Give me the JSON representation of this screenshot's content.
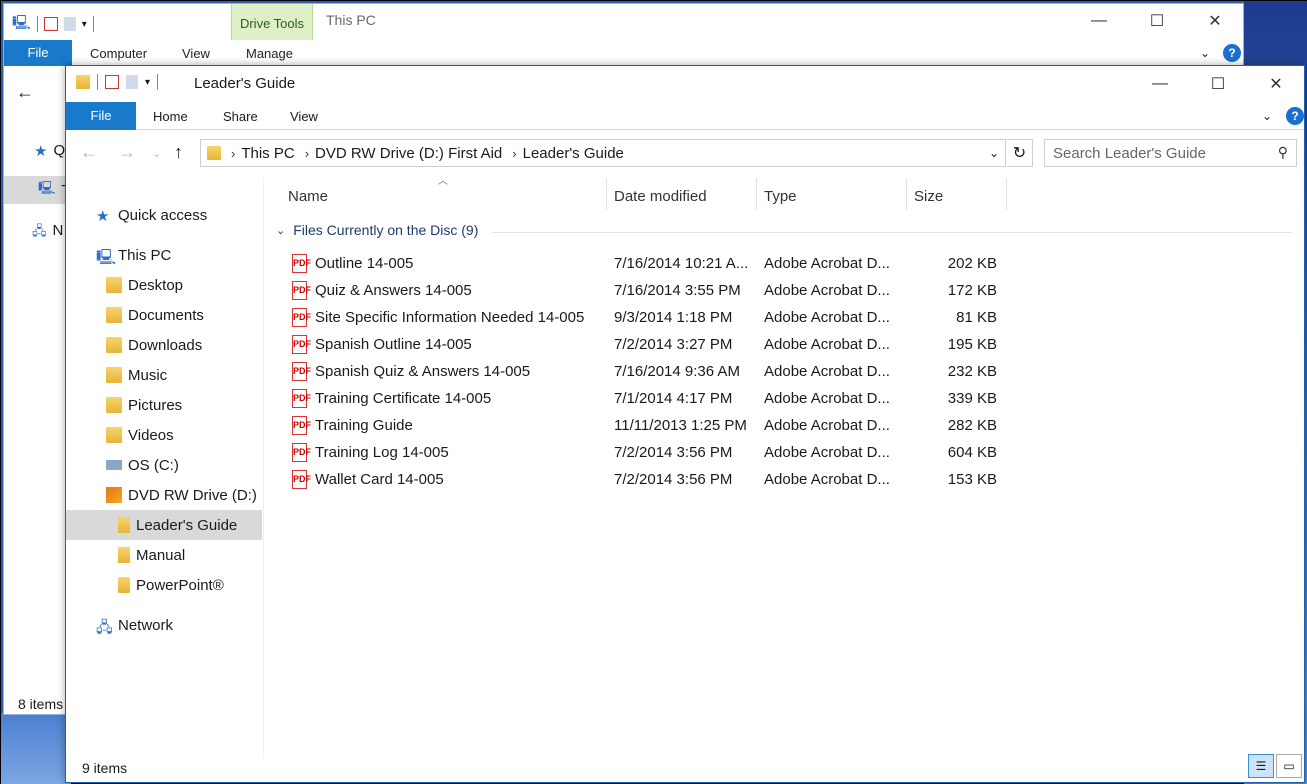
{
  "back_window": {
    "title": "This PC",
    "drive_tools": "Drive Tools",
    "tabs": [
      "File",
      "Computer",
      "View",
      "Manage"
    ],
    "sidebar_initials": [
      "Q",
      "T",
      "N"
    ],
    "status": "8 items"
  },
  "front_window": {
    "title": "Leader's Guide",
    "tabs": {
      "file": "File",
      "home": "Home",
      "share": "Share",
      "view": "View"
    },
    "breadcrumb": [
      "This PC",
      "DVD RW Drive (D:) First Aid",
      "Leader's Guide"
    ],
    "search_placeholder": "Search Leader's Guide",
    "nav": {
      "quick_access": "Quick access",
      "this_pc": "This PC",
      "desktop": "Desktop",
      "documents": "Documents",
      "downloads": "Downloads",
      "music": "Music",
      "pictures": "Pictures",
      "videos": "Videos",
      "os": "OS (C:)",
      "dvd": "DVD RW Drive (D:)",
      "leaders_guide": "Leader's Guide",
      "manual": "Manual",
      "powerpoint": "PowerPoint®",
      "network": "Network"
    },
    "columns": {
      "name": "Name",
      "date": "Date modified",
      "type": "Type",
      "size": "Size"
    },
    "group": "Files Currently on the Disc (9)",
    "files": [
      {
        "name": "Outline 14-005",
        "date": "7/16/2014 10:21 A...",
        "type": "Adobe Acrobat D...",
        "size": "202 KB"
      },
      {
        "name": "Quiz & Answers 14-005",
        "date": "7/16/2014 3:55 PM",
        "type": "Adobe Acrobat D...",
        "size": "172 KB"
      },
      {
        "name": "Site Specific Information Needed 14-005",
        "date": "9/3/2014 1:18 PM",
        "type": "Adobe Acrobat D...",
        "size": "81 KB"
      },
      {
        "name": "Spanish Outline 14-005",
        "date": "7/2/2014 3:27 PM",
        "type": "Adobe Acrobat D...",
        "size": "195 KB"
      },
      {
        "name": "Spanish Quiz & Answers 14-005",
        "date": "7/16/2014 9:36 AM",
        "type": "Adobe Acrobat D...",
        "size": "232 KB"
      },
      {
        "name": "Training Certificate 14-005",
        "date": "7/1/2014 4:17 PM",
        "type": "Adobe Acrobat D...",
        "size": "339 KB"
      },
      {
        "name": "Training Guide",
        "date": "11/11/2013 1:25 PM",
        "type": "Adobe Acrobat D...",
        "size": "282 KB"
      },
      {
        "name": "Training Log 14-005",
        "date": "7/2/2014 3:56 PM",
        "type": "Adobe Acrobat D...",
        "size": "604 KB"
      },
      {
        "name": "Wallet Card 14-005",
        "date": "7/2/2014 3:56 PM",
        "type": "Adobe Acrobat D...",
        "size": "153 KB"
      }
    ],
    "status": "9 items"
  }
}
